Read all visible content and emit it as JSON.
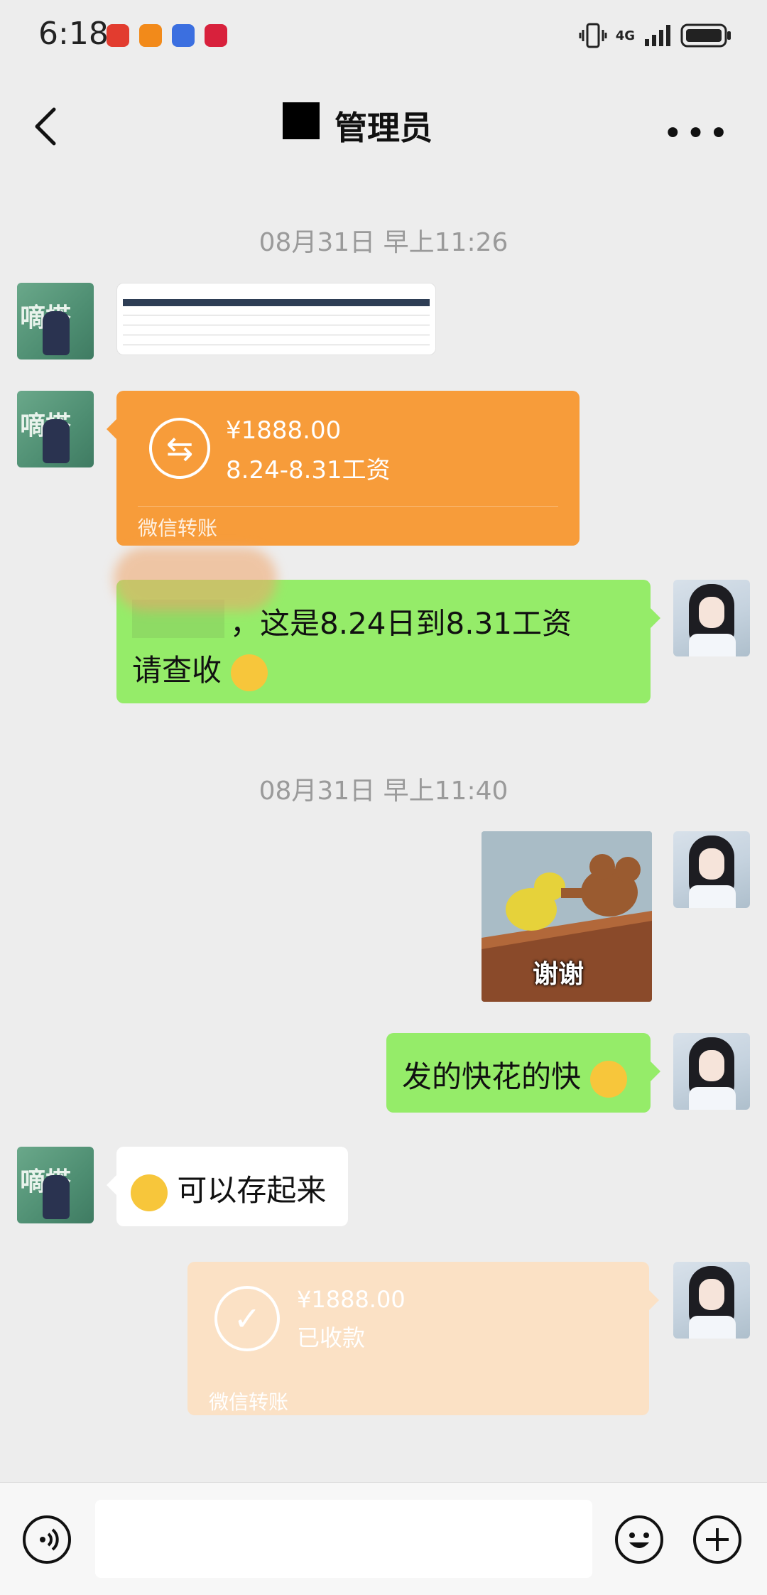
{
  "status_bar": {
    "time": "6:18",
    "network": "4G",
    "app_icons": [
      "red-app-icon",
      "fox-app-icon",
      "blue-app-icon",
      "huawei-app-icon"
    ]
  },
  "header": {
    "title": "管理员",
    "back_icon": "chevron-left-icon",
    "more_icon": "more-dots-icon"
  },
  "messages": {
    "timestamp_1": "08月31日 早上11:26",
    "transfer_1": {
      "amount": "¥1888.00",
      "note": "8.24-8.31工资",
      "footer": "微信转账"
    },
    "green_1": {
      "text_line1": "，这是8.24日到8.31工资",
      "text_line2": "请查收"
    },
    "timestamp_2": "08月31日 早上11:40",
    "sticker": {
      "caption": "谢谢"
    },
    "green_2": {
      "text": "发的快花的快"
    },
    "white_1": {
      "text": "可以存起来"
    },
    "transfer_2": {
      "amount": "¥1888.00",
      "note": "已收款",
      "footer": "微信转账"
    }
  },
  "input_bar": {
    "voice_icon": "voice-icon",
    "emoji_icon": "emoji-icon",
    "plus_icon": "plus-icon"
  }
}
